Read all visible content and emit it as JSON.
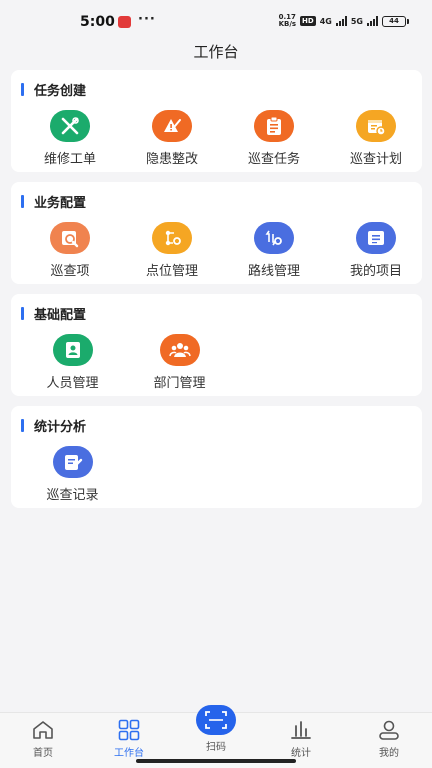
{
  "status_bar": {
    "time": "5:00",
    "dots": "···",
    "net_speed_value": "0.17",
    "net_speed_unit": "KB/s",
    "hd": "HD",
    "net1": "4G",
    "net2": "5G",
    "battery": "44"
  },
  "page_title": "工作台",
  "sections": [
    {
      "title": "任务创建",
      "items": [
        {
          "label": "维修工单",
          "icon": "wrench-screwdriver-icon",
          "color": "#1bab6c"
        },
        {
          "label": "隐患整改",
          "icon": "warning-pen-icon",
          "color": "#f06a24"
        },
        {
          "label": "巡查任务",
          "icon": "clipboard-list-icon",
          "color": "#f06a24"
        },
        {
          "label": "巡查计划",
          "icon": "calendar-clock-icon",
          "color": "#f5a623"
        }
      ]
    },
    {
      "title": "业务配置",
      "items": [
        {
          "label": "巡查项",
          "icon": "document-search-icon",
          "color": "#f0834f"
        },
        {
          "label": "点位管理",
          "icon": "location-settings-icon",
          "color": "#f5a623"
        },
        {
          "label": "路线管理",
          "icon": "route-settings-icon",
          "color": "#4a6ee0"
        },
        {
          "label": "我的项目",
          "icon": "project-card-icon",
          "color": "#4a6ee0"
        }
      ]
    },
    {
      "title": "基础配置",
      "items": [
        {
          "label": "人员管理",
          "icon": "contact-book-icon",
          "color": "#1bab6c"
        },
        {
          "label": "部门管理",
          "icon": "group-users-icon",
          "color": "#f06a24"
        }
      ]
    },
    {
      "title": "统计分析",
      "items": [
        {
          "label": "巡查记录",
          "icon": "record-edit-icon",
          "color": "#4a6ee0"
        }
      ]
    }
  ],
  "tabbar": {
    "home": "首页",
    "workbench": "工作台",
    "scan": "扫码",
    "stats": "统计",
    "mine": "我的",
    "active_color": "#2d6ff0"
  }
}
